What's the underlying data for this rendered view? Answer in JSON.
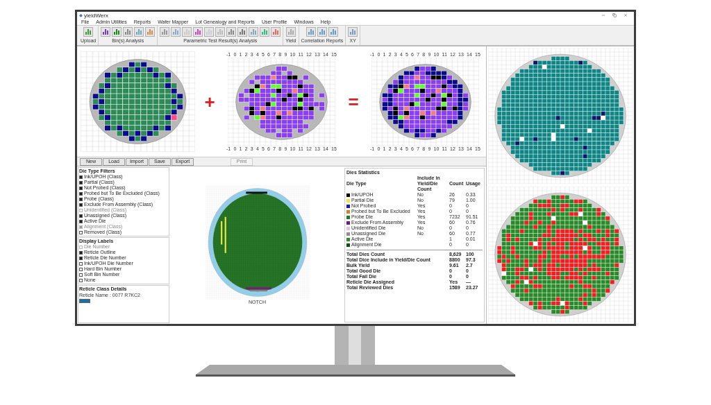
{
  "window": {
    "title": "yieldWerx"
  },
  "menu": [
    "File",
    "Admin Utilities",
    "Reports",
    "Wafer Mapper",
    "Lot Genealogy and Reports",
    "User Profile",
    "Windows",
    "Help"
  ],
  "toolbar": [
    {
      "label": "Upload"
    },
    {
      "label": "Bin(s) Analysis"
    },
    {
      "label": "Parametric Test Result(s) Analysis"
    },
    {
      "label": "Yield"
    },
    {
      "label": "Correlation Reports"
    },
    {
      "label": "XY"
    }
  ],
  "composition": {
    "maps": [
      {
        "kind": "bin"
      },
      {
        "kind": "param",
        "top_ticks": [
          "-1",
          "0",
          "1",
          "2",
          "3",
          "4",
          "5",
          "6",
          "7",
          "8",
          "9",
          "10",
          "11",
          "12",
          "13",
          "14",
          "15"
        ],
        "bottom_ticks": [
          "-1",
          "0",
          "1",
          "2",
          "3",
          "4",
          "5",
          "6",
          "7",
          "8",
          "9",
          "10",
          "11",
          "12",
          "13",
          "14",
          "15"
        ]
      },
      {
        "kind": "combined",
        "top_ticks": [
          "-1",
          "0",
          "1",
          "2",
          "3",
          "4",
          "5",
          "6",
          "7",
          "8",
          "9",
          "10",
          "11",
          "12",
          "13",
          "14",
          "15"
        ],
        "bottom_ticks": [
          "-1",
          "0",
          "1",
          "2",
          "3",
          "4",
          "5",
          "6",
          "7",
          "8",
          "9",
          "10",
          "11",
          "12",
          "13",
          "14",
          "15"
        ]
      }
    ],
    "operators": [
      "+",
      "="
    ]
  },
  "side_maps": [
    {
      "kind": "teal"
    },
    {
      "kind": "redgreen"
    }
  ],
  "map_buttons": [
    {
      "label": "New",
      "disabled": false
    },
    {
      "label": "Load",
      "disabled": false
    },
    {
      "label": "Import",
      "disabled": false
    },
    {
      "label": "Save",
      "disabled": false
    },
    {
      "label": "Export",
      "disabled": false
    },
    {
      "label": "Print",
      "disabled": true
    }
  ],
  "filters": [
    {
      "title": "Die Type Filters",
      "items": [
        {
          "label": "Ink/UPOH (Class)",
          "checked": true,
          "disabled": false
        },
        {
          "label": "Partial (Class)",
          "checked": true,
          "disabled": false
        },
        {
          "label": "Not Probed (Class)",
          "checked": true,
          "disabled": false
        },
        {
          "label": "Probed but To Be Excluded (Class)",
          "checked": true,
          "disabled": false
        },
        {
          "label": "Probe (Class)",
          "checked": true,
          "disabled": false
        },
        {
          "label": "Exclude From Assembly (Class)",
          "checked": true,
          "disabled": false
        },
        {
          "label": "Unidentified (Class)",
          "checked": false,
          "disabled": true
        },
        {
          "label": "Unassigned (Class)",
          "checked": true,
          "disabled": false
        },
        {
          "label": "Active Die",
          "checked": true,
          "disabled": false
        },
        {
          "label": "Alignment (Class)",
          "checked": true,
          "disabled": true
        },
        {
          "label": "Removed (Class)",
          "checked": false,
          "disabled": false
        }
      ]
    },
    {
      "title": "Display Labels",
      "items": [
        {
          "label": "Die Number",
          "checked": false,
          "disabled": true
        },
        {
          "label": "Reticle Outline",
          "checked": true,
          "disabled": false
        },
        {
          "label": "Reticle Die Number",
          "checked": true,
          "disabled": false
        },
        {
          "label": "Ink/UPOH Die Number",
          "checked": false,
          "disabled": false
        },
        {
          "label": "Hard Bin Number",
          "checked": false,
          "disabled": false
        },
        {
          "label": "Soft Bin Number",
          "checked": false,
          "disabled": false
        },
        {
          "label": "None",
          "checked": false,
          "disabled": false
        }
      ]
    }
  ],
  "reticle_details": {
    "title": "Reticle Class Details",
    "text": "Reticle Name : 0077 R7KC2"
  },
  "reticle_map": {
    "kind": "reticle",
    "notch_label": "NOTCH"
  },
  "die_statistics": {
    "title": "Dies Statistics",
    "columns": [
      "Die Type",
      "Include in Yield/Die Count",
      "Count",
      "Usage"
    ],
    "rows": [
      {
        "type": "Ink/UPOH",
        "include": "No",
        "count": "26",
        "usage": "0.33",
        "color": "#000000"
      },
      {
        "type": "Partial Die",
        "include": "No",
        "count": "79",
        "usage": "1.00",
        "color": "#e8e84a"
      },
      {
        "type": "Not Probed",
        "include": "Yes",
        "count": "0",
        "usage": "0",
        "color": "#1a1aa0"
      },
      {
        "type": "Probed but To Be Excluded",
        "include": "Yes",
        "count": "0",
        "usage": "0",
        "color": "#d08030"
      },
      {
        "type": "Probe Die",
        "include": "Yes",
        "count": "7232",
        "usage": "91.51",
        "color": "#1e7a1e"
      },
      {
        "type": "Exclude From Assembly",
        "include": "Yes",
        "count": "60",
        "usage": "0.76",
        "color": "#6a1a8a"
      },
      {
        "type": "Unidentified Die",
        "include": "No",
        "count": "0",
        "usage": "0",
        "color": "#e8c0e0"
      },
      {
        "type": "Unassigned Die",
        "include": "No",
        "count": "60",
        "usage": "0.77",
        "color": "#909090"
      },
      {
        "type": "Active Die",
        "include": "",
        "count": "1",
        "usage": "0.01",
        "color": "#2e8b2e"
      },
      {
        "type": "Alignment Die",
        "include": "",
        "count": "0",
        "usage": "0",
        "color": "#0f4f0f"
      }
    ],
    "totals": [
      {
        "label": "Total Dies Count",
        "value": "8,629",
        "usage": "100"
      },
      {
        "label": "Total Dice Include in Yield/Die Count",
        "value": "8800",
        "usage": "97.3"
      },
      {
        "label": "Bulk Yield",
        "value": "9.61",
        "usage": "2.7"
      },
      {
        "label": "Total Good Die",
        "value": "0",
        "usage": "0"
      },
      {
        "label": "Total Fail Die",
        "value": "0",
        "usage": "0"
      },
      {
        "label": "Reticle Die Assigned",
        "value": "Yes",
        "usage": "—"
      },
      {
        "label": "Total Reviewed Dies",
        "value": "1589",
        "usage": "23.27"
      }
    ]
  }
}
